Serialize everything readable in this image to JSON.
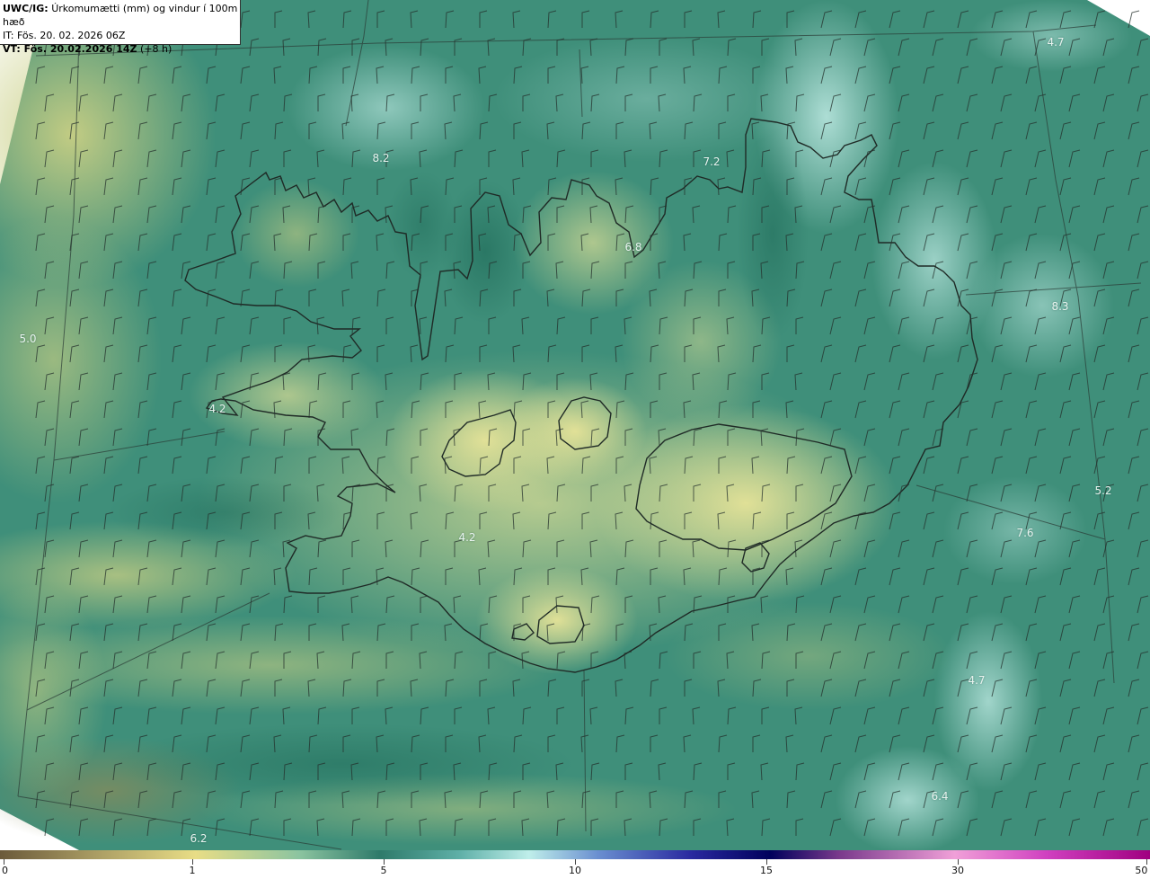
{
  "header": {
    "model": "UWC/IG:",
    "field": "Úrkomumætti (mm) og vindur í 100m hæð",
    "init_time": "IT: Fös. 20. 02. 2026 06Z",
    "valid_prefix": "VT: Fös. 20.02.2026 14Z",
    "valid_offset": "(+8 h)"
  },
  "value_labels": [
    "4.7",
    "8.2",
    "7.2",
    "6.8",
    "5.0",
    "8.3",
    "4.2",
    "4.2",
    "5.2",
    "7.6",
    "6.2",
    "6.4",
    "4.7"
  ],
  "colorbar": {
    "ticks": [
      "0",
      "1",
      "5",
      "10",
      "15",
      "30",
      "50"
    ],
    "colors": [
      "#6b5a3a",
      "#a89a62",
      "#e8dd86",
      "#8cc4a0",
      "#2e7a6a",
      "#5fb0a8",
      "#bfeeea",
      "#6a8fd0",
      "#2a2aa0",
      "#00005c",
      "#7a3a8c",
      "#f0a0d8",
      "#d040c0",
      "#a00080"
    ]
  }
}
